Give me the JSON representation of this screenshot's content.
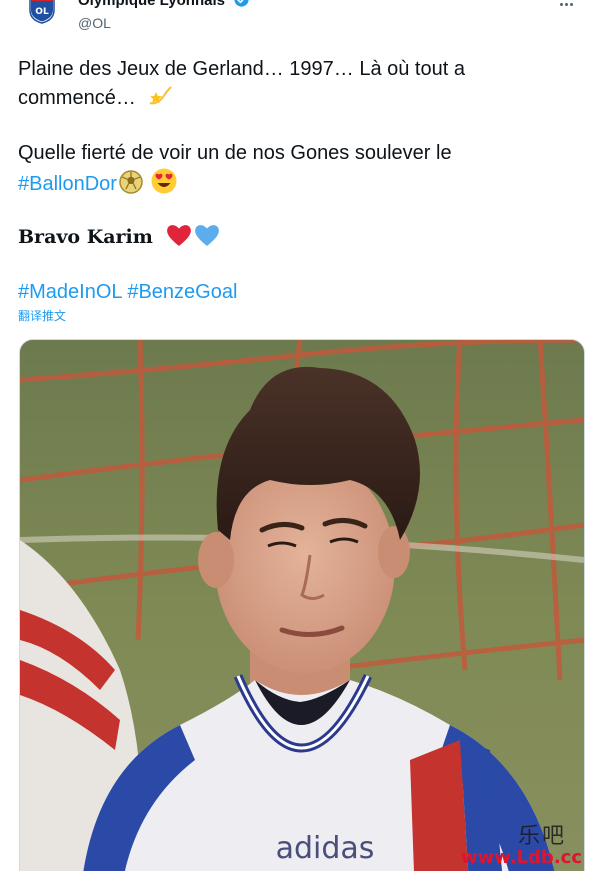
{
  "author": {
    "display_name": "Olympique Lyonnais",
    "handle": "@OL",
    "avatar_icon": "ol-crest-icon",
    "verified_icon": "verified-badge-icon",
    "verified_color": "#1d9bf0"
  },
  "tweet": {
    "line1": "Plaine des Jeux de Gerland… 1997… Là où tout a",
    "line2": "commencé…",
    "line2_emoji": "dizzy-star-emoji",
    "line3": "Quelle fierté de voir un de nos Gones soulever le",
    "hashtag_ballondor": "#BallonDor",
    "line4_emoji1": "soccer-ball-emoji",
    "line4_emoji2": "heart-eyes-emoji",
    "bravo": "Bravo Karim",
    "bravo_emoji1": "red-heart-emoji",
    "bravo_emoji2": "blue-heart-emoji",
    "hashtag_madeinol": "#MadeInOL",
    "hashtag_benzegoal": "#BenzeGoal",
    "translate_link": "翻译推文"
  },
  "photo": {
    "jersey_text": "adidas"
  },
  "watermark": {
    "text": "www.Ldb.cc",
    "logo_text": "乐吧"
  },
  "colors": {
    "link": "#1d9bf0",
    "text": "#0f1419",
    "secondary": "#536471"
  }
}
